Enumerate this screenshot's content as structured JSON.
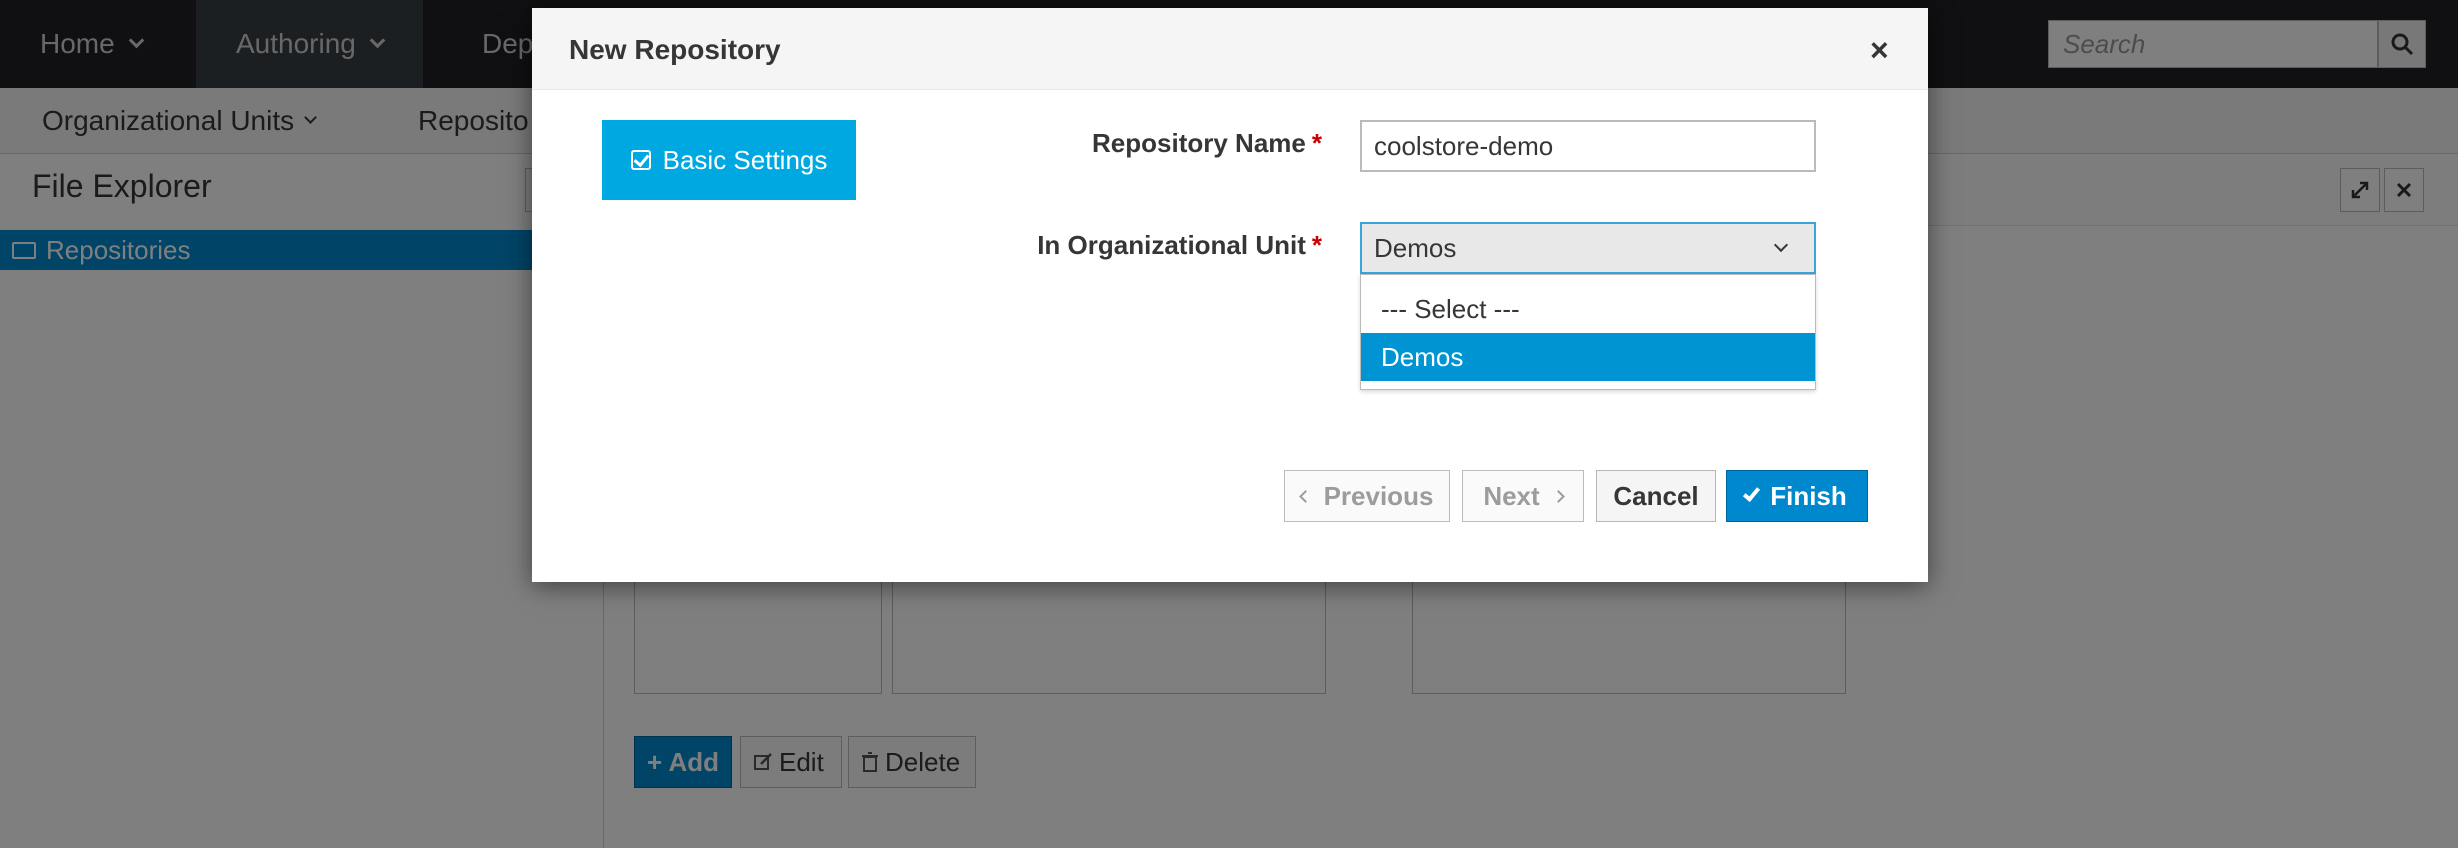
{
  "topnav": {
    "items": [
      {
        "label": "Home"
      },
      {
        "label": "Authoring"
      },
      {
        "label": "Dep"
      }
    ],
    "search_placeholder": "Search"
  },
  "subnav": {
    "items": [
      {
        "label": "Organizational Units"
      },
      {
        "label": "Reposito"
      }
    ]
  },
  "file_explorer": {
    "title": "File Explorer",
    "root_label": "Repositories"
  },
  "actions": {
    "add_label": "+ Add",
    "edit_label": "Edit",
    "delete_label": "Delete"
  },
  "modal": {
    "title": "New Repository",
    "close_glyph": "×",
    "step_label": "Basic Settings",
    "repo_name_label": "Repository Name",
    "repo_name_value": "coolstore-demo",
    "org_unit_label": "In Organizational Unit",
    "org_unit_selected": "Demos",
    "org_unit_options": [
      "--- Select ---",
      "Demos"
    ],
    "required_mark": "*",
    "buttons": {
      "previous": "Previous",
      "next": "Next",
      "cancel": "Cancel",
      "finish": "Finish"
    }
  },
  "colors": {
    "primary": "#0088ce",
    "step_active": "#00a8e1",
    "required": "#cc0000",
    "topnav_bg": "#202124"
  }
}
